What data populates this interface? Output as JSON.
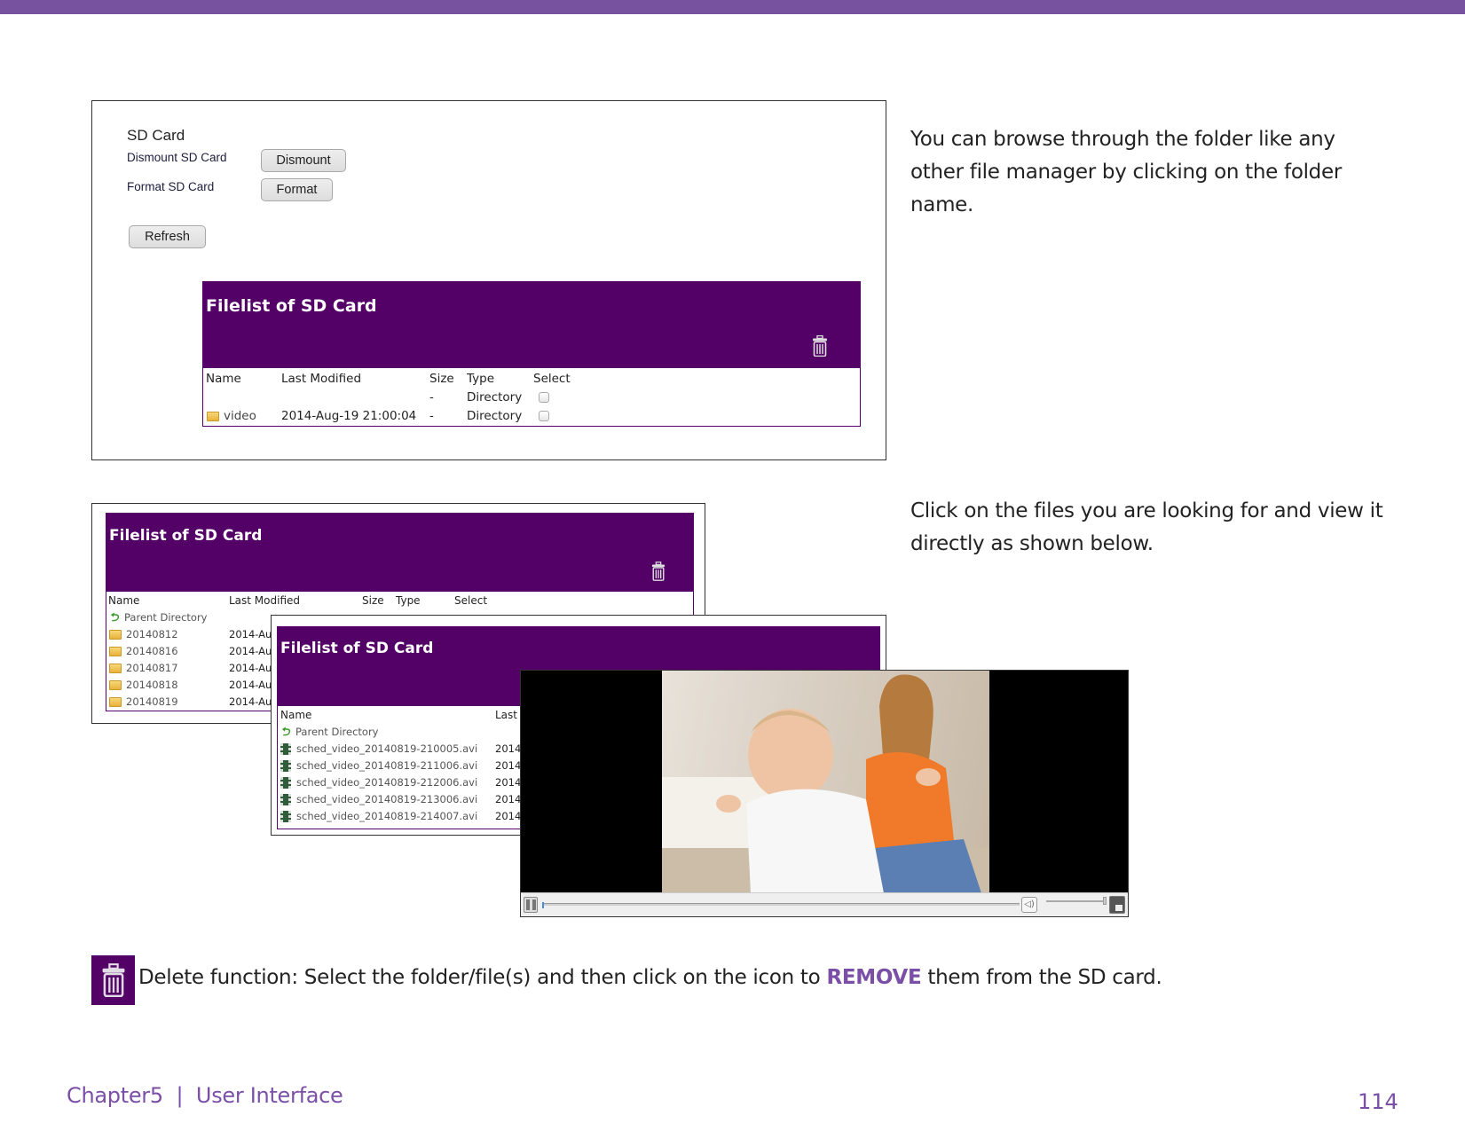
{
  "theme": {
    "accent": "#77529e",
    "filelist_header": "#530067",
    "remove_color": "#7b4fa7"
  },
  "panel1": {
    "sd_title": "SD Card",
    "dismount_label": "Dismount SD Card",
    "dismount_button": "Dismount",
    "format_label": "Format SD Card",
    "format_button": "Format",
    "refresh_button": "Refresh",
    "filelist": {
      "title": "Filelist of SD Card",
      "columns": [
        "Name",
        "Last Modified",
        "Size",
        "Type",
        "Select"
      ],
      "rows": [
        {
          "name": "",
          "modified": "",
          "size": "-",
          "type": "Directory",
          "icon": ""
        },
        {
          "name": "video",
          "modified": "2014-Aug-19 21:00:04",
          "size": "-",
          "type": "Directory",
          "icon": "folder-icon"
        }
      ]
    }
  },
  "panel2": {
    "filelist": {
      "title": "Filelist of SD Card",
      "columns": [
        "Name",
        "Last Modified",
        "Size",
        "Type",
        "Select"
      ],
      "parent": "Parent Directory",
      "rows": [
        {
          "name": "20140812",
          "modified": "2014-Au"
        },
        {
          "name": "20140816",
          "modified": "2014-Au"
        },
        {
          "name": "20140817",
          "modified": "2014-Au"
        },
        {
          "name": "20140818",
          "modified": "2014-Au"
        },
        {
          "name": "20140819",
          "modified": "2014-Au"
        }
      ]
    }
  },
  "panel3": {
    "filelist": {
      "title": "Filelist of SD Card",
      "columns": [
        "Name",
        "Last"
      ],
      "parent": "Parent Directory",
      "rows": [
        {
          "name": "sched_video_20140819-210005.avi",
          "modified": "2014"
        },
        {
          "name": "sched_video_20140819-211006.avi",
          "modified": "2014"
        },
        {
          "name": "sched_video_20140819-212006.avi",
          "modified": "2014"
        },
        {
          "name": "sched_video_20140819-213006.avi",
          "modified": "2014"
        },
        {
          "name": "sched_video_20140819-214007.avi",
          "modified": "2014"
        }
      ]
    }
  },
  "video_player": {
    "progress": 0.0,
    "volume": 1.0,
    "controls": [
      "pause-icon",
      "seek-bar",
      "volume-icon",
      "volume-slider",
      "fullscreen-icon"
    ]
  },
  "text": {
    "para1_line1": "You can browse through the folder like any",
    "para1_line2": "other file manager by clicking on the folder",
    "para1_line3": "name.",
    "para2_line1": "Click on the files you are looking for and view it",
    "para2_line2": "directly as shown below.",
    "delete_prefix": "Delete function: Select the folder/file(s) and then click on the icon to ",
    "delete_keyword": "REMOVE",
    "delete_suffix": " them from the SD card."
  },
  "footer": {
    "chapter": "Chapter5  |  User Interface",
    "page_number": "114"
  }
}
